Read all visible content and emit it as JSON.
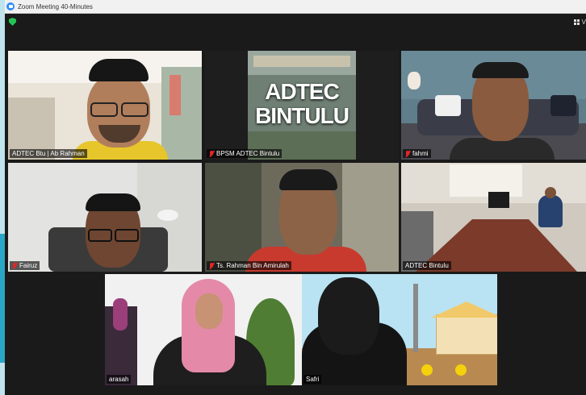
{
  "window": {
    "title": "Zoom Meeting 40-Minutes"
  },
  "toolbar": {
    "view_label": "V"
  },
  "colors": {
    "active_speaker": "#e6e600",
    "muted": "#e02828",
    "zoom_blue": "#2d8cff",
    "secure_green": "#23c552"
  },
  "participants": [
    {
      "name": "ADTEC Btu | Ab Rahman",
      "muted": false
    },
    {
      "name": "BPSM ADTEC Bintulu",
      "muted": true,
      "video_text": [
        "ADTEC",
        "BINTULU"
      ]
    },
    {
      "name": "fahmi",
      "muted": true
    },
    {
      "name": "Fairuz",
      "muted": true
    },
    {
      "name": "Ts. Rahman Bin Amirulah",
      "muted": true
    },
    {
      "name": "ADTEC Bintulu",
      "muted": false
    },
    {
      "name": "arasah",
      "muted": false,
      "active_speaker": true
    },
    {
      "name": "Safri",
      "muted": false
    }
  ]
}
